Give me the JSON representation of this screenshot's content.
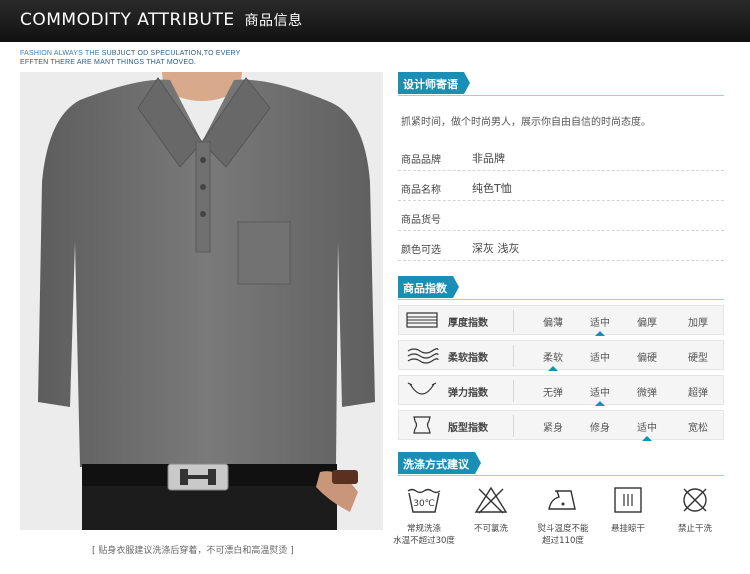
{
  "header": {
    "title": "COMMODITY ATTRIBUTE",
    "title_cn": "商品信息"
  },
  "tagline": {
    "line1_a": "FASHION ALWAYS THE",
    "line1_b": "SUBJUCT OD SPECULATION,TO EVERY",
    "line2": "EFFTEN THERE ARE MANT THINGS THAT MOVEO."
  },
  "photo": {
    "caption": "[ 贴身衣服建议洗涤后穿着，不可漂白和高温熨烫 ]"
  },
  "designer": {
    "heading": "设计师寄语",
    "slogan": "抓紧时间，做个时尚男人，展示你自由自信的时尚态度。"
  },
  "attributes": [
    {
      "label": "商品品牌",
      "value": "非品牌"
    },
    {
      "label": "商品名称",
      "value": "纯色T恤"
    },
    {
      "label": "商品货号",
      "value": ""
    },
    {
      "label": "颜色可选",
      "value": "深灰 浅灰"
    }
  ],
  "index": {
    "heading": "商品指数",
    "rows": [
      {
        "icon": "thickness-icon",
        "label": "厚度指数",
        "options": [
          "偏薄",
          "适中",
          "偏厚",
          "加厚"
        ],
        "selected": 1
      },
      {
        "icon": "softness-icon",
        "label": "柔软指数",
        "options": [
          "柔软",
          "适中",
          "偏硬",
          "硬型"
        ],
        "selected": 0
      },
      {
        "icon": "elasticity-icon",
        "label": "弹力指数",
        "options": [
          "无弹",
          "适中",
          "微弹",
          "超弹"
        ],
        "selected": 1
      },
      {
        "icon": "fit-icon",
        "label": "版型指数",
        "options": [
          "紧身",
          "修身",
          "适中",
          "宽松"
        ],
        "selected": 2
      }
    ]
  },
  "wash": {
    "heading": "洗涤方式建议",
    "tub_temp": "30℃",
    "items": [
      {
        "icon": "wash-tub-icon",
        "line1": "常规洗涤",
        "line2": "水温不超过30度"
      },
      {
        "icon": "no-bleach-icon",
        "line1": "不可氯洗",
        "line2": ""
      },
      {
        "icon": "iron-icon",
        "line1": "熨斗温度不能",
        "line2": "超过110度"
      },
      {
        "icon": "hang-dry-icon",
        "line1": "悬挂晾干",
        "line2": ""
      },
      {
        "icon": "no-dry-clean-icon",
        "line1": "禁止干洗",
        "line2": ""
      }
    ]
  },
  "colors": {
    "accent": "#1a8fb5",
    "header_bg": "#1a1a1a",
    "shirt": "#6f6f6f"
  }
}
